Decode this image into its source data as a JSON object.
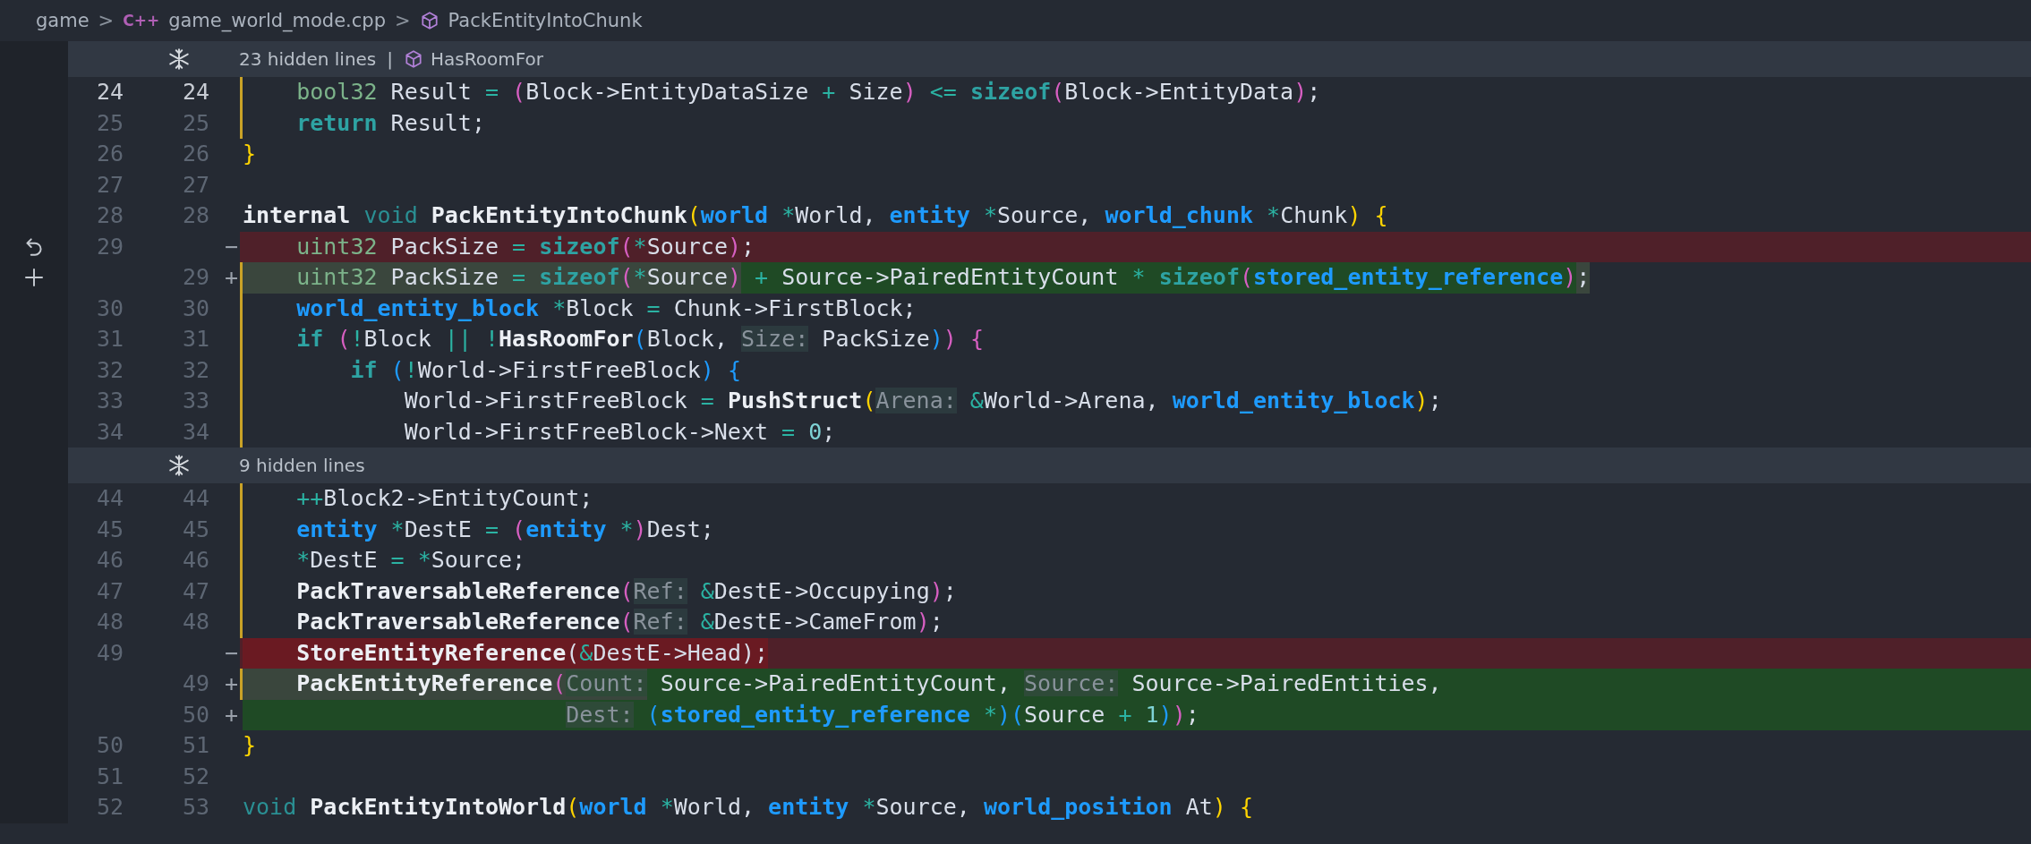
{
  "breadcrumb": {
    "folder": "game",
    "separators": [
      ">",
      ">"
    ],
    "file_badge": "C++",
    "file": "game_world_mode.cpp",
    "symbol": "PackEntityIntoChunk"
  },
  "blocks": [
    {
      "kind": "hidden",
      "label": "23 hidden lines",
      "divider": "|",
      "symbol": "HasRoomFor"
    },
    {
      "kind": "lines",
      "rows": [
        {
          "old": "24",
          "new": "24",
          "kind": "context",
          "current": true,
          "modified": true,
          "tokens": [
            {
              "kind": "prim",
              "text": "    bool32"
            },
            {
              "kind": "plain",
              "text": " Result "
            },
            {
              "kind": "op",
              "text": "="
            },
            {
              "kind": "pp",
              "text": " ("
            },
            {
              "kind": "plain",
              "text": "Block->EntityDataSize "
            },
            {
              "kind": "op",
              "text": "+"
            },
            {
              "kind": "plain",
              "text": " Size"
            },
            {
              "kind": "pp",
              "text": ")"
            },
            {
              "kind": "op",
              "text": " <="
            },
            {
              "kind": "kw",
              "text": " sizeof"
            },
            {
              "kind": "pp",
              "text": "("
            },
            {
              "kind": "plain",
              "text": "Block->EntityData"
            },
            {
              "kind": "pp",
              "text": ")"
            },
            {
              "kind": "plain",
              "text": ";"
            }
          ]
        },
        {
          "old": "25",
          "new": "25",
          "kind": "context",
          "current": false,
          "modified": true,
          "tokens": [
            {
              "kind": "kw",
              "text": "    return"
            },
            {
              "kind": "plain",
              "text": " Result;"
            }
          ]
        },
        {
          "old": "26",
          "new": "26",
          "kind": "context",
          "current": false,
          "modified": false,
          "tokens": [
            {
              "kind": "py",
              "text": "}"
            }
          ]
        },
        {
          "old": "27",
          "new": "27",
          "kind": "context",
          "current": false,
          "modified": false
        },
        {
          "old": "28",
          "new": "28",
          "kind": "context",
          "current": false,
          "modified": false,
          "tokens": [
            {
              "kind": "fn",
              "text": "internal"
            },
            {
              "kind": "kwl",
              "text": " void"
            },
            {
              "kind": "fn",
              "text": " PackEntityIntoChunk"
            },
            {
              "kind": "py",
              "text": "("
            },
            {
              "kind": "ty",
              "text": "world"
            },
            {
              "kind": "op",
              "text": " *"
            },
            {
              "kind": "plain",
              "text": "World, "
            },
            {
              "kind": "ty",
              "text": "entity"
            },
            {
              "kind": "op",
              "text": " *"
            },
            {
              "kind": "plain",
              "text": "Source, "
            },
            {
              "kind": "ty",
              "text": "world_chunk"
            },
            {
              "kind": "op",
              "text": " *"
            },
            {
              "kind": "plain",
              "text": "Chunk"
            },
            {
              "kind": "py",
              "text": ")"
            },
            {
              "kind": "py",
              "text": " {"
            }
          ]
        },
        {
          "old": "29",
          "sign": "−",
          "kind": "removed",
          "current": false,
          "modified": false,
          "tokens": [
            {
              "kind": "prim",
              "text": "    uint32",
              "changed": false
            },
            {
              "kind": "plain",
              "text": " PackSize ",
              "changed": false
            },
            {
              "kind": "op",
              "text": "=",
              "changed": false
            },
            {
              "kind": "kw",
              "text": " sizeof",
              "changed": false
            },
            {
              "kind": "pp",
              "text": "(",
              "changed": false
            },
            {
              "kind": "op",
              "text": "*",
              "changed": false
            },
            {
              "kind": "plain",
              "text": "Source",
              "changed": false
            },
            {
              "kind": "pp",
              "text": ")",
              "changed": false
            },
            {
              "kind": "plain",
              "text": ";",
              "changed": false
            }
          ]
        },
        {
          "new": "29",
          "sign": "+",
          "kind": "added",
          "current": false,
          "modified": true,
          "tokens": [
            {
              "kind": "prim",
              "text": "    uint32",
              "changed": false
            },
            {
              "kind": "plain",
              "text": " PackSize ",
              "changed": false
            },
            {
              "kind": "op",
              "text": "=",
              "changed": false
            },
            {
              "kind": "kw",
              "text": " sizeof",
              "changed": false
            },
            {
              "kind": "pp",
              "text": "(",
              "changed": false
            },
            {
              "kind": "op",
              "text": "*",
              "changed": false
            },
            {
              "kind": "plain",
              "text": "Source",
              "changed": false
            },
            {
              "kind": "pp",
              "text": ")",
              "changed": false
            },
            {
              "kind": "op",
              "text": " +",
              "changed": true
            },
            {
              "kind": "plain",
              "text": " Source->PairedEntityCount ",
              "changed": true
            },
            {
              "kind": "op",
              "text": "*",
              "changed": true
            },
            {
              "kind": "kw",
              "text": " sizeof",
              "changed": true
            },
            {
              "kind": "pp",
              "text": "(",
              "changed": true
            },
            {
              "kind": "ty",
              "text": "stored_entity_reference",
              "changed": true
            },
            {
              "kind": "pp",
              "text": ")",
              "changed": true
            },
            {
              "kind": "plain",
              "text": ";",
              "changed": false
            }
          ]
        },
        {
          "old": "30",
          "new": "30",
          "kind": "context",
          "current": false,
          "modified": true,
          "tokens": [
            {
              "kind": "ty",
              "text": "    world_entity_block"
            },
            {
              "kind": "op",
              "text": " *"
            },
            {
              "kind": "plain",
              "text": "Block "
            },
            {
              "kind": "op",
              "text": "="
            },
            {
              "kind": "plain",
              "text": " Chunk->FirstBlock;"
            }
          ]
        },
        {
          "old": "31",
          "new": "31",
          "kind": "context",
          "current": false,
          "modified": true,
          "tokens": [
            {
              "kind": "kw",
              "text": "    if"
            },
            {
              "kind": "pp",
              "text": " ("
            },
            {
              "kind": "op",
              "text": "!"
            },
            {
              "kind": "plain",
              "text": "Block "
            },
            {
              "kind": "op",
              "text": "||"
            },
            {
              "kind": "op",
              "text": " !"
            },
            {
              "kind": "fn",
              "text": "HasRoomFor"
            },
            {
              "kind": "pb",
              "text": "("
            },
            {
              "kind": "plain",
              "text": "Block, "
            },
            {
              "kind": "hint",
              "text": "Size:"
            },
            {
              "kind": "plain",
              "text": " PackSize"
            },
            {
              "kind": "pb",
              "text": ")"
            },
            {
              "kind": "pp",
              "text": ")"
            },
            {
              "kind": "pp",
              "text": " {"
            }
          ]
        },
        {
          "old": "32",
          "new": "32",
          "kind": "context",
          "current": false,
          "modified": true,
          "tokens": [
            {
              "kind": "kw",
              "text": "        if"
            },
            {
              "kind": "pb",
              "text": " ("
            },
            {
              "kind": "op",
              "text": "!"
            },
            {
              "kind": "plain",
              "text": "World->FirstFreeBlock"
            },
            {
              "kind": "pb",
              "text": ")"
            },
            {
              "kind": "pb",
              "text": " {"
            }
          ]
        },
        {
          "old": "33",
          "new": "33",
          "kind": "context",
          "current": false,
          "modified": true,
          "tokens": [
            {
              "kind": "plain",
              "text": "            World->FirstFreeBlock "
            },
            {
              "kind": "op",
              "text": "="
            },
            {
              "kind": "fn",
              "text": " PushStruct"
            },
            {
              "kind": "py",
              "text": "("
            },
            {
              "kind": "hint",
              "text": "Arena:"
            },
            {
              "kind": "op",
              "text": " &"
            },
            {
              "kind": "plain",
              "text": "World->Arena, "
            },
            {
              "kind": "ty",
              "text": "world_entity_block"
            },
            {
              "kind": "py",
              "text": ")"
            },
            {
              "kind": "plain",
              "text": ";"
            }
          ]
        },
        {
          "old": "34",
          "new": "34",
          "kind": "context",
          "current": false,
          "modified": true,
          "tokens": [
            {
              "kind": "plain",
              "text": "            World->FirstFreeBlock->Next "
            },
            {
              "kind": "op",
              "text": "="
            },
            {
              "kind": "num",
              "text": " 0"
            },
            {
              "kind": "plain",
              "text": ";"
            }
          ]
        }
      ]
    },
    {
      "kind": "hidden",
      "label": "9 hidden lines"
    },
    {
      "kind": "lines",
      "rows": [
        {
          "old": "44",
          "new": "44",
          "kind": "context",
          "current": false,
          "modified": true,
          "tokens": [
            {
              "kind": "op",
              "text": "    ++"
            },
            {
              "kind": "plain",
              "text": "Block2->EntityCount;"
            }
          ]
        },
        {
          "old": "45",
          "new": "45",
          "kind": "context",
          "current": false,
          "modified": true,
          "tokens": [
            {
              "kind": "ty",
              "text": "    entity"
            },
            {
              "kind": "op",
              "text": " *"
            },
            {
              "kind": "plain",
              "text": "DestE "
            },
            {
              "kind": "op",
              "text": "="
            },
            {
              "kind": "pp",
              "text": " ("
            },
            {
              "kind": "ty",
              "text": "entity"
            },
            {
              "kind": "op",
              "text": " *"
            },
            {
              "kind": "pp",
              "text": ")"
            },
            {
              "kind": "plain",
              "text": "Dest;"
            }
          ]
        },
        {
          "old": "46",
          "new": "46",
          "kind": "context",
          "current": false,
          "modified": true,
          "tokens": [
            {
              "kind": "op",
              "text": "    *"
            },
            {
              "kind": "plain",
              "text": "DestE "
            },
            {
              "kind": "op",
              "text": "="
            },
            {
              "kind": "op",
              "text": " *"
            },
            {
              "kind": "plain",
              "text": "Source;"
            }
          ]
        },
        {
          "old": "47",
          "new": "47",
          "kind": "context",
          "current": false,
          "modified": true,
          "tokens": [
            {
              "kind": "fn",
              "text": "    PackTraversableReference"
            },
            {
              "kind": "pp",
              "text": "("
            },
            {
              "kind": "hint",
              "text": "Ref:"
            },
            {
              "kind": "op",
              "text": " &"
            },
            {
              "kind": "plain",
              "text": "DestE->Occupying"
            },
            {
              "kind": "pp",
              "text": ")"
            },
            {
              "kind": "plain",
              "text": ";"
            }
          ]
        },
        {
          "old": "48",
          "new": "48",
          "kind": "context",
          "current": false,
          "modified": true,
          "tokens": [
            {
              "kind": "fn",
              "text": "    PackTraversableReference"
            },
            {
              "kind": "pp",
              "text": "("
            },
            {
              "kind": "hint",
              "text": "Ref:"
            },
            {
              "kind": "op",
              "text": " &"
            },
            {
              "kind": "plain",
              "text": "DestE->CameFrom"
            },
            {
              "kind": "pp",
              "text": ")"
            },
            {
              "kind": "plain",
              "text": ";"
            }
          ]
        },
        {
          "old": "49",
          "sign": "−",
          "kind": "removed",
          "current": false,
          "modified": false,
          "tokens": [
            {
              "kind": "fn",
              "text": "    StoreEntityReference",
              "changed": true
            },
            {
              "kind": "plain",
              "text": "(",
              "changed": true
            },
            {
              "kind": "op",
              "text": "&",
              "changed": true
            },
            {
              "kind": "plain",
              "text": "DestE->Head);",
              "changed": true
            }
          ]
        },
        {
          "new": "49",
          "sign": "+",
          "kind": "added",
          "current": false,
          "modified": true,
          "tokens": [
            {
              "kind": "fn",
              "text": "    PackEntityReference",
              "changed": false
            },
            {
              "kind": "pp",
              "text": "(",
              "changed": false
            },
            {
              "kind": "hint",
              "text": "Count:",
              "changed": false
            },
            {
              "kind": "plain",
              "text": " Source->PairedEntityCount, ",
              "changed": true
            },
            {
              "kind": "hint",
              "text": "Source:",
              "changed": true
            },
            {
              "kind": "plain",
              "text": " Source->PairedEntities,",
              "changed": true
            }
          ]
        },
        {
          "new": "50",
          "sign": "+",
          "kind": "added",
          "current": false,
          "modified": false,
          "tokens": [
            {
              "kind": "hint",
              "text": "                        Dest:",
              "changed": true
            },
            {
              "kind": "pb",
              "text": " (",
              "changed": true
            },
            {
              "kind": "ty",
              "text": "stored_entity_reference",
              "changed": true
            },
            {
              "kind": "op",
              "text": " *",
              "changed": true
            },
            {
              "kind": "pb",
              "text": ")",
              "changed": true
            },
            {
              "kind": "pb",
              "text": "(",
              "changed": true
            },
            {
              "kind": "plain",
              "text": "Source ",
              "changed": true
            },
            {
              "kind": "op",
              "text": "+",
              "changed": true
            },
            {
              "kind": "num",
              "text": " 1",
              "changed": true
            },
            {
              "kind": "pb",
              "text": ")",
              "changed": true
            },
            {
              "kind": "pp",
              "text": ")",
              "changed": true
            },
            {
              "kind": "plain",
              "text": ";",
              "changed": true
            }
          ]
        },
        {
          "old": "50",
          "new": "51",
          "kind": "context",
          "current": false,
          "modified": false,
          "tokens": [
            {
              "kind": "py",
              "text": "}"
            }
          ]
        },
        {
          "old": "51",
          "new": "52",
          "kind": "context",
          "current": false,
          "modified": false
        },
        {
          "old": "52",
          "new": "53",
          "kind": "context",
          "current": false,
          "modified": false,
          "tokens": [
            {
              "kind": "kwl",
              "text": "void"
            },
            {
              "kind": "fn",
              "text": " PackEntityIntoWorld"
            },
            {
              "kind": "py",
              "text": "("
            },
            {
              "kind": "ty",
              "text": "world"
            },
            {
              "kind": "op",
              "text": " *"
            },
            {
              "kind": "plain",
              "text": "World, "
            },
            {
              "kind": "ty",
              "text": "entity"
            },
            {
              "kind": "op",
              "text": " *"
            },
            {
              "kind": "plain",
              "text": "Source, "
            },
            {
              "kind": "ty",
              "text": "world_position"
            },
            {
              "kind": "plain",
              "text": " At"
            },
            {
              "kind": "py",
              "text": ")"
            },
            {
              "kind": "py",
              "text": " {"
            }
          ]
        }
      ]
    }
  ]
}
